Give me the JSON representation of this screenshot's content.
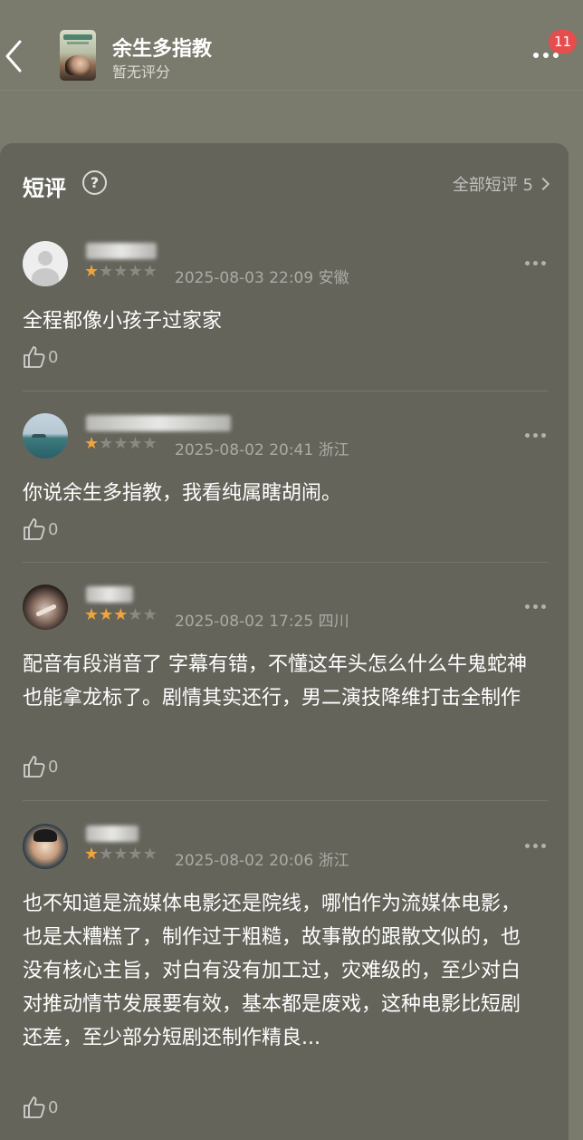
{
  "header": {
    "title": "余生多指教",
    "subtitle": "暂无评分",
    "badge": "11"
  },
  "section": {
    "title": "短评",
    "help_icon": "?",
    "all_link": "全部短评 5"
  },
  "reviews": [
    {
      "rating": 1,
      "date": "2025-08-03 22:09",
      "location": "安徽",
      "text": "全程都像小孩子过家家",
      "likes": "0"
    },
    {
      "rating": 1,
      "date": "2025-08-02 20:41",
      "location": "浙江",
      "text": "你说余生多指教，我看纯属瞎胡闹。",
      "likes": "0"
    },
    {
      "rating": 3,
      "date": "2025-08-02 17:25",
      "location": "四川",
      "text": "配音有段消音了 字幕有错，不懂这年头怎么什么牛鬼蛇神也能拿龙标了。剧情其实还行，男二演技降维打击全制作",
      "likes": "0"
    },
    {
      "rating": 1,
      "date": "2025-08-02 20:06",
      "location": "浙江",
      "text": "也不知道是流媒体电影还是院线，哪怕作为流媒体电影，也是太糟糕了，制作过于粗糙，故事散的跟散文似的，也没有核心主旨，对白有没有加工过，灾难级的，至少对白对推动情节发展要有效，基本都是废戏，这种电影比短剧还差，至少部分短剧还制作精良...",
      "likes": "0"
    }
  ],
  "colors": {
    "background": "#7a7a6d",
    "card": "#65645b",
    "star_on": "#f2a33a",
    "badge": "#e84d4d"
  }
}
